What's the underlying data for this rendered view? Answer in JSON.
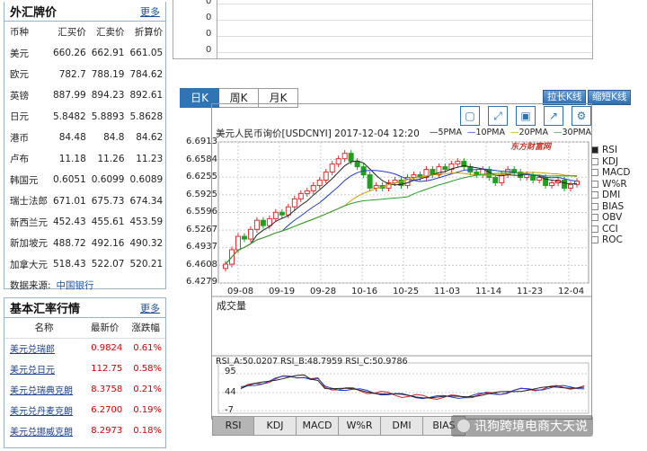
{
  "fx_panel": {
    "title": "外汇牌价",
    "more": "更多",
    "headers": [
      "币种",
      "汇买价",
      "汇卖价",
      "折算价"
    ],
    "rows": [
      [
        "美元",
        "660.26",
        "662.91",
        "661.05"
      ],
      [
        "欧元",
        "782.7",
        "788.19",
        "784.62"
      ],
      [
        "英镑",
        "887.99",
        "894.23",
        "892.61"
      ],
      [
        "日元",
        "5.8482",
        "5.8893",
        "5.8628"
      ],
      [
        "港币",
        "84.48",
        "84.8",
        "84.62"
      ],
      [
        "卢布",
        "11.18",
        "11.26",
        "11.23"
      ],
      [
        "韩国元",
        "0.6051",
        "0.6099",
        "0.6089"
      ],
      [
        "瑞士法郎",
        "671.01",
        "675.73",
        "674.34"
      ],
      [
        "新西兰元",
        "452.43",
        "455.61",
        "453.59"
      ],
      [
        "新加坡元",
        "488.72",
        "492.16",
        "490.32"
      ],
      [
        "加拿大元",
        "518.43",
        "522.07",
        "520.21"
      ]
    ],
    "source_label": "数据来源:",
    "source_link": "中国银行"
  },
  "rate_panel": {
    "title": "基本汇率行情",
    "more": "更多",
    "headers": [
      "名称",
      "最新价",
      "涨跌幅"
    ],
    "rows": [
      [
        "美元兑瑞郎",
        "0.9824",
        "0.61%"
      ],
      [
        "美元兑日元",
        "112.75",
        "0.58%"
      ],
      [
        "美元兑瑞典克朗",
        "8.3758",
        "0.21%"
      ],
      [
        "美元兑丹麦克朗",
        "6.2700",
        "0.19%"
      ],
      [
        "美元兑挪威克朗",
        "8.2973",
        "0.18%"
      ]
    ]
  },
  "top_chart": {
    "labels": [
      "0",
      "0",
      "0",
      "0"
    ]
  },
  "period_tabs": [
    "日K",
    "周K",
    "月K"
  ],
  "buttons": {
    "stretch": "拉长K线",
    "shrink": "缩短K线"
  },
  "toolbar_icons": [
    "restore-icon",
    "fullscreen-icon",
    "save-icon",
    "share-icon",
    "settings-icon"
  ],
  "chart": {
    "title": "美元人民币询价[USDCNYI] 2017-12-04 12:20",
    "ma_legend": [
      "5PMA",
      "10PMA",
      "20PMA",
      "30PMA"
    ],
    "ma_colors": [
      "#222222",
      "#1f3fd0",
      "#c8a000",
      "#2aa02a"
    ],
    "logo": "东方财富网",
    "y_ticks": [
      "6.6913",
      "6.6584",
      "6.6255",
      "6.5925",
      "6.5596",
      "6.5267",
      "6.4937",
      "6.4608",
      "6.4279"
    ],
    "x_ticks": [
      "09-08",
      "09-19",
      "09-28",
      "10-16",
      "10-25",
      "11-03",
      "11-14",
      "11-23",
      "12-04"
    ],
    "up_color": "#e03030",
    "down_color": "#20a020"
  },
  "indicators": [
    {
      "name": "RSI",
      "checked": true
    },
    {
      "name": "KDJ",
      "checked": false
    },
    {
      "name": "MACD",
      "checked": false
    },
    {
      "name": "W%R",
      "checked": false
    },
    {
      "name": "DMI",
      "checked": false
    },
    {
      "name": "BIAS",
      "checked": false
    },
    {
      "name": "OBV",
      "checked": false
    },
    {
      "name": "CCI",
      "checked": false
    },
    {
      "name": "ROC",
      "checked": false
    }
  ],
  "volume": {
    "label": "成交量"
  },
  "rsi": {
    "legend": "RSI_A:50.0207  RSI_B:48.7959  RSI_C:50.9786",
    "y_ticks": [
      "95",
      "44",
      "-7"
    ]
  },
  "indicator_tabs": [
    "RSI",
    "KDJ",
    "MACD",
    "W%R",
    "DMI",
    "BIAS"
  ],
  "watermark": "讯狗跨境电商大天说"
}
